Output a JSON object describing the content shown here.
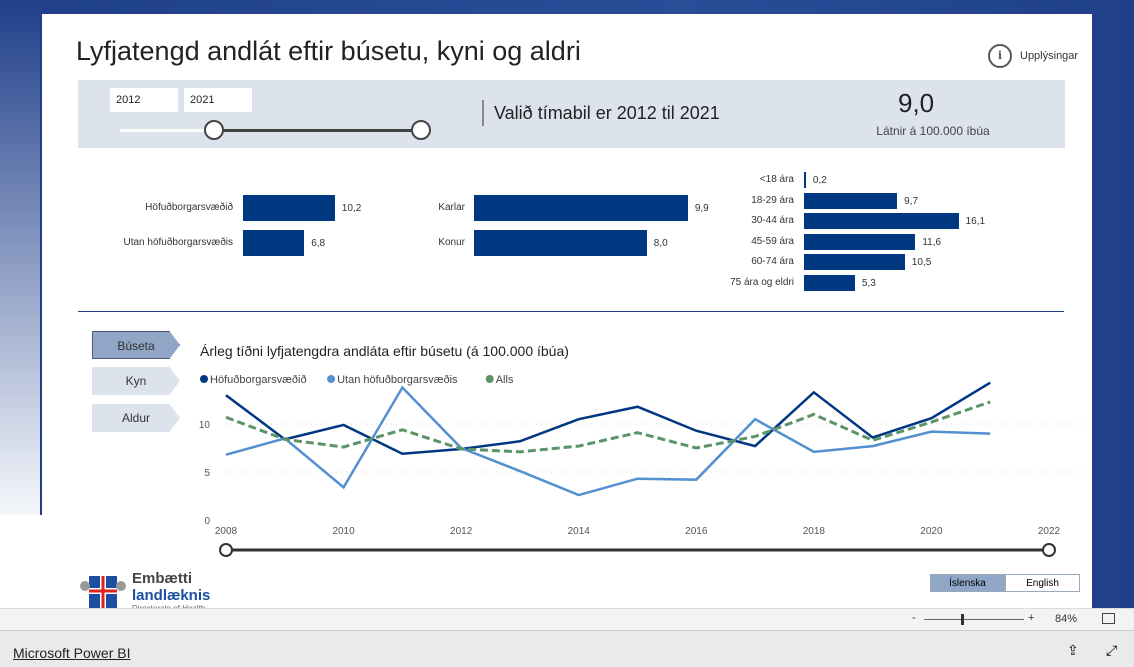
{
  "title": "Lyfjatengd andlát eftir búsetu, kyni og aldri",
  "info_label": "Upplýsingar",
  "slicer": {
    "from": "2012",
    "to": "2021"
  },
  "period_text": "Valið tímabil er 2012 til 2021",
  "kpi": {
    "value": "9,0",
    "label": "Látnir á 100.000 íbúa"
  },
  "residence_bars": [
    {
      "label": "Höfuðborgarsvæðið",
      "value": 10.2,
      "text": "10,2"
    },
    {
      "label": "Utan höfuðborgarsvæðis",
      "value": 6.8,
      "text": "6,8"
    }
  ],
  "sex_bars": [
    {
      "label": "Karlar",
      "value": 9.9,
      "text": "9,9"
    },
    {
      "label": "Konur",
      "value": 8.0,
      "text": "8,0"
    }
  ],
  "age_bars": [
    {
      "label": "<18 ára",
      "value": 0.2,
      "text": "0,2"
    },
    {
      "label": "18-29 ára",
      "value": 9.7,
      "text": "9,7"
    },
    {
      "label": "30-44 ára",
      "value": 16.1,
      "text": "16,1"
    },
    {
      "label": "45-59 ára",
      "value": 11.6,
      "text": "11,6"
    },
    {
      "label": "60-74 ára",
      "value": 10.5,
      "text": "10,5"
    },
    {
      "label": "75 ára og eldri",
      "value": 5.3,
      "text": "5,3"
    }
  ],
  "nav": [
    "Búseta",
    "Kyn",
    "Aldur"
  ],
  "colors": {
    "dark": "#003781",
    "light": "#5390d0",
    "green": "#5a9468",
    "bar": "#003781"
  },
  "chart_data": {
    "type": "line",
    "title": "Árleg tíðni lyfjatengdra andláta eftir búsetu (á 100.000 íbúa)",
    "x": [
      2008,
      2009,
      2010,
      2011,
      2012,
      2013,
      2014,
      2015,
      2016,
      2017,
      2018,
      2019,
      2020,
      2021
    ],
    "xticks": [
      "2008",
      "2010",
      "2012",
      "2014",
      "2016",
      "2018",
      "2020",
      "2022"
    ],
    "yticks": [
      "0",
      "5",
      "10"
    ],
    "xlim": [
      2008,
      2022
    ],
    "ylim": [
      0,
      15
    ],
    "grid": true,
    "legend": "top-left",
    "series": [
      {
        "name": "Höfuðborgarsvæðið",
        "color": "#003781",
        "dash": false,
        "values": [
          13.0,
          8.4,
          9.9,
          6.9,
          7.4,
          8.2,
          10.5,
          11.8,
          9.3,
          7.7,
          13.3,
          8.6,
          10.6,
          14.3
        ]
      },
      {
        "name": "Utan höfuðborgarsvæðis",
        "color": "#5390d0",
        "dash": false,
        "values": [
          6.8,
          8.5,
          3.4,
          13.8,
          7.5,
          5.1,
          2.6,
          4.3,
          4.2,
          10.5,
          7.1,
          7.7,
          9.2,
          9.0
        ]
      },
      {
        "name": "Alls",
        "color": "#5a9468",
        "dash": true,
        "values": [
          10.7,
          8.4,
          7.6,
          9.4,
          7.4,
          7.1,
          7.7,
          9.1,
          7.5,
          8.7,
          11.0,
          8.3,
          10.2,
          12.3
        ]
      }
    ]
  },
  "logo": {
    "line1": "Embætti",
    "line2": "landlæknis",
    "line3": "Directorate of Health"
  },
  "languages": [
    "Íslenska",
    "English"
  ],
  "zoom": "84%",
  "footer": {
    "brand": "Microsoft Power BI"
  }
}
